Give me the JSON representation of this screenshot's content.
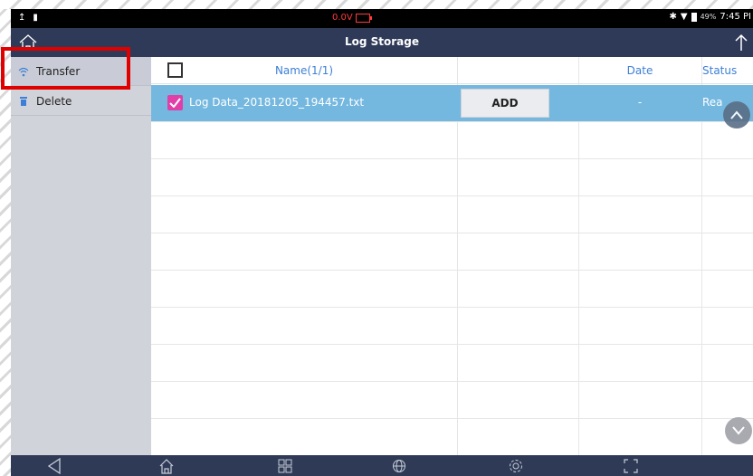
{
  "status_bar": {
    "voltage": "0.0V",
    "battery_percent": "49%",
    "time": "7:45 PI",
    "colors": {
      "voltage": "#ff3b3b"
    }
  },
  "header": {
    "title": "Log Storage",
    "home_icon": "home-icon",
    "export_icon": "upload-icon"
  },
  "sidebar": {
    "items": [
      {
        "label": "Transfer",
        "icon": "wifi-icon"
      },
      {
        "label": "Delete",
        "icon": "trash-icon"
      }
    ]
  },
  "table": {
    "columns": [
      "Name(1/1)",
      "",
      "Date",
      "Status"
    ],
    "rows": [
      {
        "checked": true,
        "name": "Log Data_20181205_194457.txt",
        "action": "ADD",
        "date": "-",
        "status": "Rea"
      }
    ],
    "empty_rows": 8
  },
  "navigation": {
    "icons": [
      "back-icon",
      "home-icon",
      "apps-icon",
      "globe-icon",
      "settings-icon",
      "screenshot-icon"
    ]
  },
  "colors": {
    "header_bg": "#2f3a58",
    "sidebar_bg": "#d1d3db",
    "selected_row": "#74b8e0",
    "checkbox_checked": "#e03fa8",
    "accent_text": "#3d7fd6",
    "highlight": "#e00000"
  }
}
